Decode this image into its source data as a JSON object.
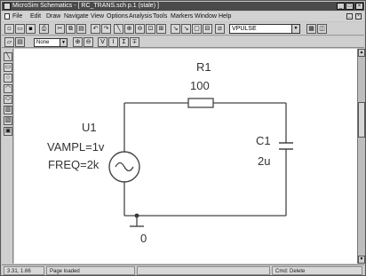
{
  "window": {
    "title": "MicroSim Schematics - [ RC_TRANS.sch  p.1 (stale) ]",
    "controls": [
      "_",
      "□",
      "×"
    ]
  },
  "menubar": {
    "items": [
      "File",
      "Edit",
      "Draw",
      "Navigate",
      "View",
      "Options",
      "Analysis",
      "Tools",
      "Markers",
      "Window",
      "Help"
    ],
    "doc_controls": [
      "_",
      "×"
    ]
  },
  "toolbar": {
    "part_browser_value": "VPULSE",
    "layer_value": "None"
  },
  "schematic": {
    "resistor": {
      "name": "R1",
      "value": "100"
    },
    "capacitor": {
      "name": "C1",
      "value": "2u"
    },
    "source": {
      "name": "U1",
      "vampl": "VAMPL=1v",
      "freq": "FREQ=2k"
    },
    "ground_label": "0"
  },
  "statusbar": {
    "coords": "3.31, 1.66",
    "message": "Page loaded",
    "command": "Cmd: Delete"
  }
}
